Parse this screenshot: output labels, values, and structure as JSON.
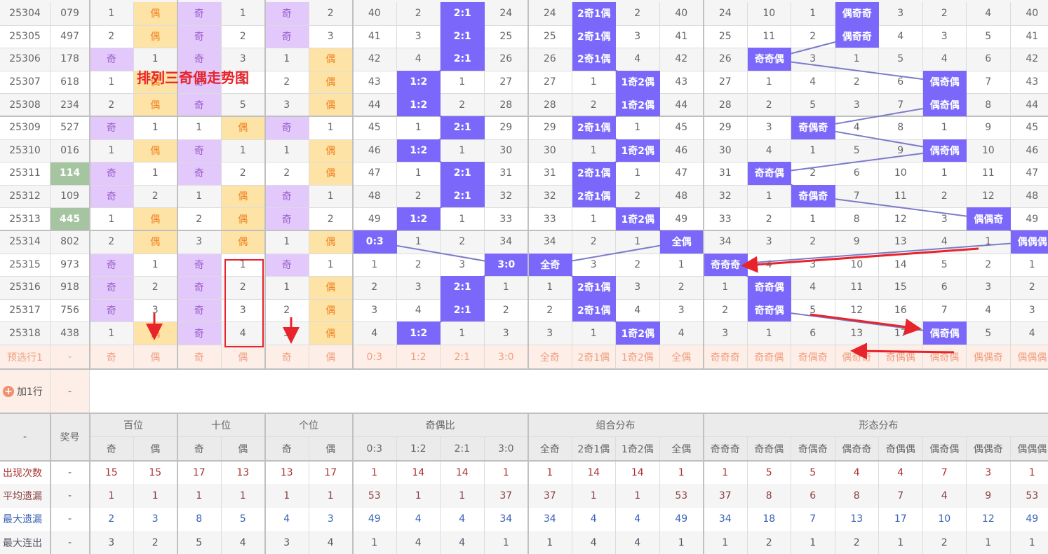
{
  "annotation_title": "排列三奇偶走势图",
  "colors": {
    "odd_bg": "#e2c8fb",
    "even_bg": "#fde3a5",
    "highlight": "#7b68fb",
    "line": "#7b7bc8",
    "annotation": "#e8232b"
  },
  "rows": [
    {
      "period": "25304",
      "prize": "079",
      "green": false,
      "cells": [
        "1",
        "偶",
        "奇",
        "1",
        "奇",
        "2",
        "40",
        "2",
        "2:1",
        "24",
        "24",
        "2奇1偶",
        "2",
        "40",
        "24",
        "10",
        "1",
        "偶奇奇",
        "3",
        "2",
        "4",
        "40"
      ]
    },
    {
      "period": "25305",
      "prize": "497",
      "green": false,
      "cells": [
        "2",
        "偶",
        "奇",
        "2",
        "奇",
        "3",
        "41",
        "3",
        "2:1",
        "25",
        "25",
        "2奇1偶",
        "3",
        "41",
        "25",
        "11",
        "2",
        "偶奇奇",
        "4",
        "3",
        "5",
        "41"
      ]
    },
    {
      "period": "25306",
      "prize": "178",
      "green": false,
      "cells": [
        "奇",
        "1",
        "奇",
        "3",
        "1",
        "偶",
        "42",
        "4",
        "2:1",
        "26",
        "26",
        "2奇1偶",
        "4",
        "42",
        "26",
        "奇奇偶",
        "3",
        "1",
        "5",
        "4",
        "6",
        "42"
      ]
    },
    {
      "period": "25307",
      "prize": "618",
      "green": false,
      "cells": [
        "1",
        "偶",
        "奇",
        "4",
        "2",
        "偶",
        "43",
        "1:2",
        "1",
        "27",
        "27",
        "1",
        "1奇2偶",
        "43",
        "27",
        "1",
        "4",
        "2",
        "6",
        "偶奇偶",
        "7",
        "43"
      ]
    },
    {
      "period": "25308",
      "prize": "234",
      "green": false,
      "cells": [
        "2",
        "偶",
        "奇",
        "5",
        "3",
        "偶",
        "44",
        "1:2",
        "2",
        "28",
        "28",
        "2",
        "1奇2偶",
        "44",
        "28",
        "2",
        "5",
        "3",
        "7",
        "偶奇偶",
        "8",
        "44"
      ]
    },
    {
      "period": "25309",
      "prize": "527",
      "green": false,
      "cells": [
        "奇",
        "1",
        "1",
        "偶",
        "奇",
        "1",
        "45",
        "1",
        "2:1",
        "29",
        "29",
        "2奇1偶",
        "1",
        "45",
        "29",
        "3",
        "奇偶奇",
        "4",
        "8",
        "1",
        "9",
        "45"
      ]
    },
    {
      "period": "25310",
      "prize": "016",
      "green": false,
      "cells": [
        "1",
        "偶",
        "奇",
        "1",
        "1",
        "偶",
        "46",
        "1:2",
        "1",
        "30",
        "30",
        "1",
        "1奇2偶",
        "46",
        "30",
        "4",
        "1",
        "5",
        "9",
        "偶奇偶",
        "10",
        "46"
      ]
    },
    {
      "period": "25311",
      "prize": "114",
      "green": true,
      "cells": [
        "奇",
        "1",
        "奇",
        "2",
        "2",
        "偶",
        "47",
        "1",
        "2:1",
        "31",
        "31",
        "2奇1偶",
        "1",
        "47",
        "31",
        "奇奇偶",
        "2",
        "6",
        "10",
        "1",
        "11",
        "47"
      ]
    },
    {
      "period": "25312",
      "prize": "109",
      "green": false,
      "cells": [
        "奇",
        "2",
        "1",
        "偶",
        "奇",
        "1",
        "48",
        "2",
        "2:1",
        "32",
        "32",
        "2奇1偶",
        "2",
        "48",
        "32",
        "1",
        "奇偶奇",
        "7",
        "11",
        "2",
        "12",
        "48"
      ]
    },
    {
      "period": "25313",
      "prize": "445",
      "green": true,
      "cells": [
        "1",
        "偶",
        "2",
        "偶",
        "奇",
        "2",
        "49",
        "1:2",
        "1",
        "33",
        "33",
        "1",
        "1奇2偶",
        "49",
        "33",
        "2",
        "1",
        "8",
        "12",
        "3",
        "偶偶奇",
        "49"
      ]
    },
    {
      "period": "25314",
      "prize": "802",
      "green": false,
      "cells": [
        "2",
        "偶",
        "3",
        "偶",
        "1",
        "偶",
        "0:3",
        "1",
        "2",
        "34",
        "34",
        "2",
        "1",
        "全偶",
        "34",
        "3",
        "2",
        "9",
        "13",
        "4",
        "1",
        "偶偶偶"
      ]
    },
    {
      "period": "25315",
      "prize": "973",
      "green": false,
      "cells": [
        "奇",
        "1",
        "奇",
        "1",
        "奇",
        "1",
        "1",
        "2",
        "3",
        "3:0",
        "全奇",
        "3",
        "2",
        "1",
        "奇奇奇",
        "4",
        "3",
        "10",
        "14",
        "5",
        "2",
        "1"
      ]
    },
    {
      "period": "25316",
      "prize": "918",
      "green": false,
      "cells": [
        "奇",
        "2",
        "奇",
        "2",
        "1",
        "偶",
        "2",
        "3",
        "2:1",
        "1",
        "1",
        "2奇1偶",
        "3",
        "2",
        "1",
        "奇奇偶",
        "4",
        "11",
        "15",
        "6",
        "3",
        "2"
      ]
    },
    {
      "period": "25317",
      "prize": "756",
      "green": false,
      "cells": [
        "奇",
        "3",
        "奇",
        "3",
        "2",
        "偶",
        "3",
        "4",
        "2:1",
        "2",
        "2",
        "2奇1偶",
        "4",
        "3",
        "2",
        "奇奇偶",
        "5",
        "12",
        "16",
        "7",
        "4",
        "3"
      ]
    },
    {
      "period": "25318",
      "prize": "438",
      "green": false,
      "cells": [
        "1",
        "偶",
        "奇",
        "4",
        "3",
        "偶",
        "4",
        "1:2",
        "1",
        "3",
        "3",
        "1",
        "1奇2偶",
        "4",
        "3",
        "1",
        "6",
        "13",
        "17",
        "偶奇偶",
        "5",
        "4"
      ]
    }
  ],
  "preselect": {
    "label": "预选行1",
    "prize": "-",
    "cells": [
      "奇",
      "偶",
      "奇",
      "偶",
      "奇",
      "偶",
      "0:3",
      "1:2",
      "2:1",
      "3:0",
      "全奇",
      "2奇1偶",
      "1奇2偶",
      "全偶",
      "奇奇奇",
      "奇奇偶",
      "奇偶奇",
      "偶奇奇",
      "奇偶偶",
      "偶奇偶",
      "偶偶奇",
      "偶偶偶"
    ]
  },
  "add_row": {
    "label": "加1行",
    "prize": "-"
  },
  "header": {
    "corner": "-",
    "prize": "奖号",
    "groups": [
      "百位",
      "十位",
      "个位",
      "奇偶比",
      "组合分布",
      "形态分布"
    ],
    "sub": [
      "奇",
      "偶",
      "奇",
      "偶",
      "奇",
      "偶",
      "0:3",
      "1:2",
      "2:1",
      "3:0",
      "全奇",
      "2奇1偶",
      "1奇2偶",
      "全偶",
      "奇奇奇",
      "奇奇偶",
      "奇偶奇",
      "偶奇奇",
      "奇偶偶",
      "偶奇偶",
      "偶偶奇",
      "偶偶偶"
    ]
  },
  "stats": [
    {
      "label": "出现次数",
      "prize": "-",
      "color": "#a83232",
      "values": [
        "15",
        "15",
        "17",
        "13",
        "13",
        "17",
        "1",
        "14",
        "14",
        "1",
        "1",
        "14",
        "14",
        "1",
        "1",
        "5",
        "5",
        "4",
        "4",
        "7",
        "3",
        "1"
      ]
    },
    {
      "label": "平均遗漏",
      "prize": "-",
      "color": "#8b4040",
      "values": [
        "1",
        "1",
        "1",
        "1",
        "1",
        "1",
        "53",
        "1",
        "1",
        "37",
        "37",
        "1",
        "1",
        "53",
        "37",
        "8",
        "6",
        "8",
        "7",
        "4",
        "9",
        "53"
      ]
    },
    {
      "label": "最大遗漏",
      "prize": "-",
      "color": "#3a62b5",
      "values": [
        "2",
        "3",
        "8",
        "5",
        "4",
        "3",
        "49",
        "4",
        "4",
        "34",
        "34",
        "4",
        "4",
        "49",
        "34",
        "18",
        "7",
        "13",
        "17",
        "10",
        "12",
        "49"
      ]
    },
    {
      "label": "最大连出",
      "prize": "-",
      "color": "#555566",
      "values": [
        "3",
        "2",
        "5",
        "4",
        "3",
        "4",
        "1",
        "4",
        "4",
        "1",
        "1",
        "4",
        "4",
        "1",
        "1",
        "2",
        "1",
        "2",
        "1",
        "2",
        "1",
        "1"
      ]
    }
  ]
}
